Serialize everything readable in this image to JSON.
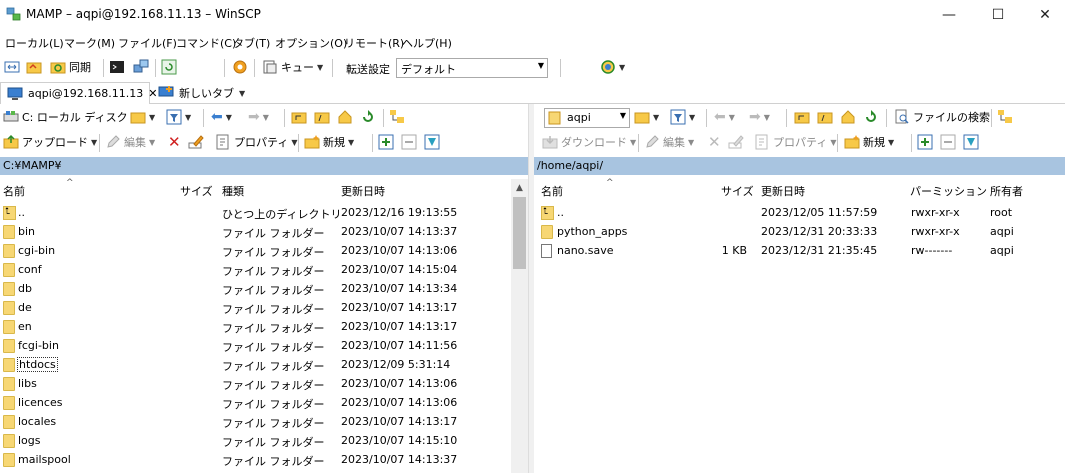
{
  "window": {
    "title": "MAMP – aqpi@192.168.11.13 – WinSCP"
  },
  "menu": [
    "ローカル(L)",
    "マーク(M)",
    "ファイル(F)",
    "コマンド(C)",
    "タブ(T)",
    "オプション(O)",
    "リモート(R)",
    "ヘルプ(H)"
  ],
  "toolbar1": {
    "sync_label": "同期",
    "queue_label": "キュー",
    "transfer_label": "転送設定",
    "transfer_value": "デフォルト"
  },
  "tabs": [
    {
      "label": "aqpi@192.168.11.13"
    },
    {
      "label": "新しいタブ"
    }
  ],
  "local": {
    "drive": "C: ローカル ディスク",
    "upload_label": "アップロード",
    "edit_label": "編集",
    "props_label": "プロパティ",
    "new_label": "新規",
    "path": "C:¥MAMP¥",
    "columns": {
      "name": "名前",
      "size": "サイズ",
      "type": "種類",
      "modified": "更新日時"
    },
    "rows": [
      {
        "kind": "up",
        "name": "..",
        "size": "",
        "type": "ひとつ上のディレクトリ",
        "modified": "2023/12/16 19:13:55"
      },
      {
        "kind": "folder",
        "name": "bin",
        "size": "",
        "type": "ファイル フォルダー",
        "modified": "2023/10/07 14:13:37"
      },
      {
        "kind": "folder",
        "name": "cgi-bin",
        "size": "",
        "type": "ファイル フォルダー",
        "modified": "2023/10/07 14:13:06"
      },
      {
        "kind": "folder",
        "name": "conf",
        "size": "",
        "type": "ファイル フォルダー",
        "modified": "2023/10/07 14:15:04"
      },
      {
        "kind": "folder",
        "name": "db",
        "size": "",
        "type": "ファイル フォルダー",
        "modified": "2023/10/07 14:13:34"
      },
      {
        "kind": "folder",
        "name": "de",
        "size": "",
        "type": "ファイル フォルダー",
        "modified": "2023/10/07 14:13:17"
      },
      {
        "kind": "folder",
        "name": "en",
        "size": "",
        "type": "ファイル フォルダー",
        "modified": "2023/10/07 14:13:17"
      },
      {
        "kind": "folder",
        "name": "fcgi-bin",
        "size": "",
        "type": "ファイル フォルダー",
        "modified": "2023/10/07 14:11:56"
      },
      {
        "kind": "folder",
        "name": "htdocs",
        "size": "",
        "type": "ファイル フォルダー",
        "modified": "2023/12/09 5:31:14"
      },
      {
        "kind": "folder",
        "name": "libs",
        "size": "",
        "type": "ファイル フォルダー",
        "modified": "2023/10/07 14:13:06"
      },
      {
        "kind": "folder",
        "name": "licences",
        "size": "",
        "type": "ファイル フォルダー",
        "modified": "2023/10/07 14:13:06"
      },
      {
        "kind": "folder",
        "name": "locales",
        "size": "",
        "type": "ファイル フォルダー",
        "modified": "2023/10/07 14:13:17"
      },
      {
        "kind": "folder",
        "name": "logs",
        "size": "",
        "type": "ファイル フォルダー",
        "modified": "2023/10/07 14:15:10"
      },
      {
        "kind": "folder",
        "name": "mailspool",
        "size": "",
        "type": "ファイル フォルダー",
        "modified": "2023/10/07 14:13:37"
      }
    ]
  },
  "remote": {
    "dir": "aqpi",
    "download_label": "ダウンロード",
    "edit_label": "編集",
    "props_label": "プロパティ",
    "new_label": "新規",
    "find_label": "ファイルの検索",
    "path": "/home/aqpi/",
    "columns": {
      "name": "名前",
      "size": "サイズ",
      "modified": "更新日時",
      "perms": "パーミッション",
      "owner": "所有者"
    },
    "rows": [
      {
        "kind": "up",
        "name": "..",
        "size": "",
        "modified": "2023/12/05 11:57:59",
        "perms": "rwxr-xr-x",
        "owner": "root"
      },
      {
        "kind": "folder",
        "name": "python_apps",
        "size": "",
        "modified": "2023/12/31 20:33:33",
        "perms": "rwxr-xr-x",
        "owner": "aqpi"
      },
      {
        "kind": "file",
        "name": "nano.save",
        "size": "1 KB",
        "modified": "2023/12/31 21:35:45",
        "perms": "rw-------",
        "owner": "aqpi"
      }
    ]
  }
}
